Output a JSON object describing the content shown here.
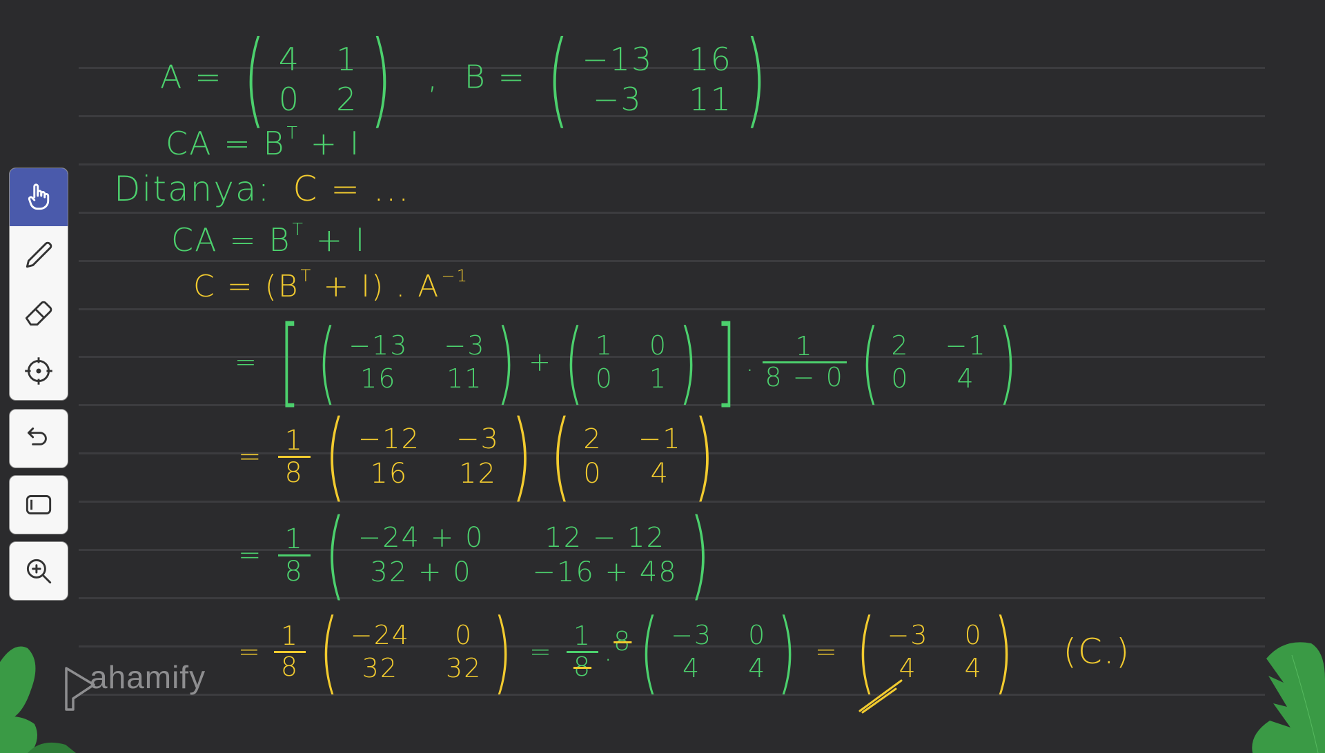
{
  "toolbar": {
    "tools": [
      {
        "name": "hand",
        "icon": "hand-pointer-icon",
        "active": true
      },
      {
        "name": "pen",
        "icon": "pencil-icon",
        "active": false
      },
      {
        "name": "eraser",
        "icon": "eraser-icon",
        "active": false
      },
      {
        "name": "laser-pointer",
        "icon": "crosshair-icon",
        "active": false
      }
    ],
    "undo": {
      "icon": "undo-icon"
    },
    "shape": {
      "icon": "rectangle-icon"
    },
    "zoom": {
      "icon": "zoom-in-icon"
    }
  },
  "colors": {
    "background": "#2b2b2d",
    "ink_green": "#4cd06d",
    "ink_yellow": "#f2cb2f",
    "active_tool": "#4a5aab"
  },
  "notes": {
    "given": {
      "a_label": "A =",
      "a_matrix": [
        [
          "4",
          "1"
        ],
        [
          "0",
          "2"
        ]
      ],
      "separator": ",",
      "b_label": "B =",
      "b_matrix": [
        [
          "−13",
          "16"
        ],
        [
          "−3",
          "11"
        ]
      ],
      "equation": "CA = B",
      "equation_sup": "T",
      "equation_tail": " + I"
    },
    "question": {
      "label": "Ditanya:",
      "asked": "C = ..."
    },
    "step1": {
      "lhs": "CA = B",
      "sup": "T",
      "rhs": "+ I"
    },
    "step2": {
      "text": "C = (B",
      "sup": "T",
      "mid": "+ I) . A",
      "sup2": "−1"
    },
    "step3": {
      "eq": "=",
      "bt_matrix": [
        [
          "−13",
          "−3"
        ],
        [
          "16",
          "11"
        ]
      ],
      "plus": "+",
      "i_matrix": [
        [
          "1",
          "0"
        ],
        [
          "0",
          "1"
        ]
      ],
      "dot": ".",
      "frac_num": "1",
      "frac_den": "8 − 0",
      "adj_matrix": [
        [
          "2",
          "−1"
        ],
        [
          "0",
          "4"
        ]
      ]
    },
    "step4": {
      "eq": "=",
      "frac_num": "1",
      "frac_den": "8",
      "m1": [
        [
          "−12",
          "−3"
        ],
        [
          "16",
          "12"
        ]
      ],
      "m2": [
        [
          "2",
          "−1"
        ],
        [
          "0",
          "4"
        ]
      ]
    },
    "step5": {
      "eq": "=",
      "frac_num": "1",
      "frac_den": "8",
      "m": [
        [
          "−24 + 0",
          "12 − 12"
        ],
        [
          "32 + 0",
          "−16 + 48"
        ]
      ]
    },
    "step6": {
      "eq": "=",
      "frac_num": "1",
      "frac_den": "8",
      "m": [
        [
          "−24",
          "0"
        ],
        [
          "32",
          "32"
        ]
      ],
      "eq2": "=",
      "frac2_num": "1",
      "frac2_den": "8",
      "dot": ".",
      "factor": "8",
      "m2": [
        [
          "−3",
          "0"
        ],
        [
          "4",
          "4"
        ]
      ],
      "eq3": "=",
      "result": [
        [
          "−3",
          "0"
        ],
        [
          "4",
          "4"
        ]
      ],
      "answer": "(C.)"
    }
  },
  "brand": {
    "logo_text": "ahamify",
    "logo_initial": "P"
  }
}
